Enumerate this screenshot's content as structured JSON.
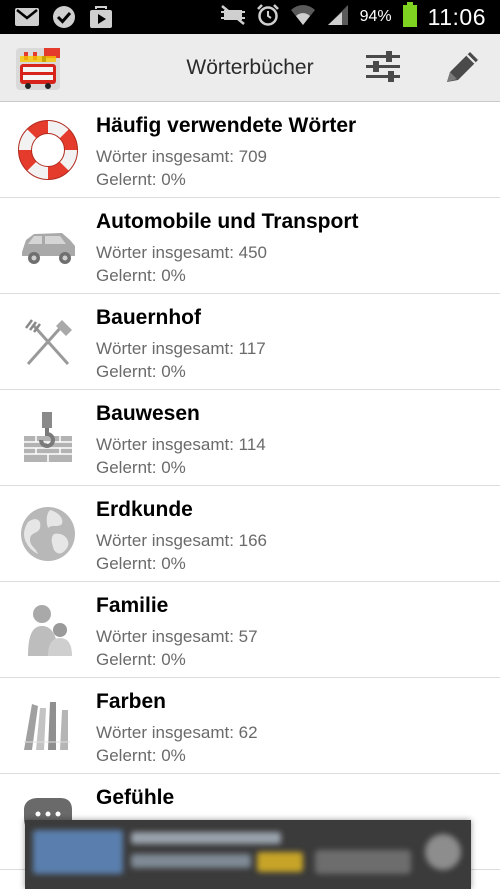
{
  "status_bar": {
    "battery": "94%",
    "time": "11:06",
    "icons": [
      "gmail-icon",
      "check-circle-icon",
      "play-store-icon",
      "mute-icon",
      "alarm-icon",
      "wifi-icon",
      "signal-icon",
      "battery-icon"
    ]
  },
  "action_bar": {
    "title": "Wörterbücher",
    "app_icon": "bus-flags-app-icon",
    "settings_icon": "sliders-icon",
    "edit_icon": "pencil-icon"
  },
  "dictionaries": [
    {
      "title": "Häufig verwendete Wörter",
      "total": "Wörter insgesamt: 709",
      "learned": "Gelernt: 0%",
      "icon": "lifebuoy-icon"
    },
    {
      "title": "Automobile und Transport",
      "total": "Wörter insgesamt: 450",
      "learned": "Gelernt: 0%",
      "icon": "car-icon"
    },
    {
      "title": "Bauernhof",
      "total": "Wörter insgesamt: 117",
      "learned": "Gelernt: 0%",
      "icon": "farm-tools-icon"
    },
    {
      "title": "Bauwesen",
      "total": "Wörter insgesamt: 114",
      "learned": "Gelernt: 0%",
      "icon": "construction-icon"
    },
    {
      "title": "Erdkunde",
      "total": "Wörter insgesamt: 166",
      "learned": "Gelernt: 0%",
      "icon": "globe-icon"
    },
    {
      "title": "Familie",
      "total": "Wörter insgesamt: 57",
      "learned": "Gelernt: 0%",
      "icon": "family-icon"
    },
    {
      "title": "Farben",
      "total": "Wörter insgesamt: 62",
      "learned": "Gelernt: 0%",
      "icon": "pencils-icon"
    },
    {
      "title": "Gefühle",
      "total": "",
      "learned": "",
      "icon": "speech-bubble-icon"
    }
  ],
  "colors": {
    "status_bar": "#000000",
    "action_bar": "#ececec",
    "battery": "#7fd321",
    "lifebuoy_red": "#e53b2c",
    "icon_gray": "#9a9a9a"
  }
}
